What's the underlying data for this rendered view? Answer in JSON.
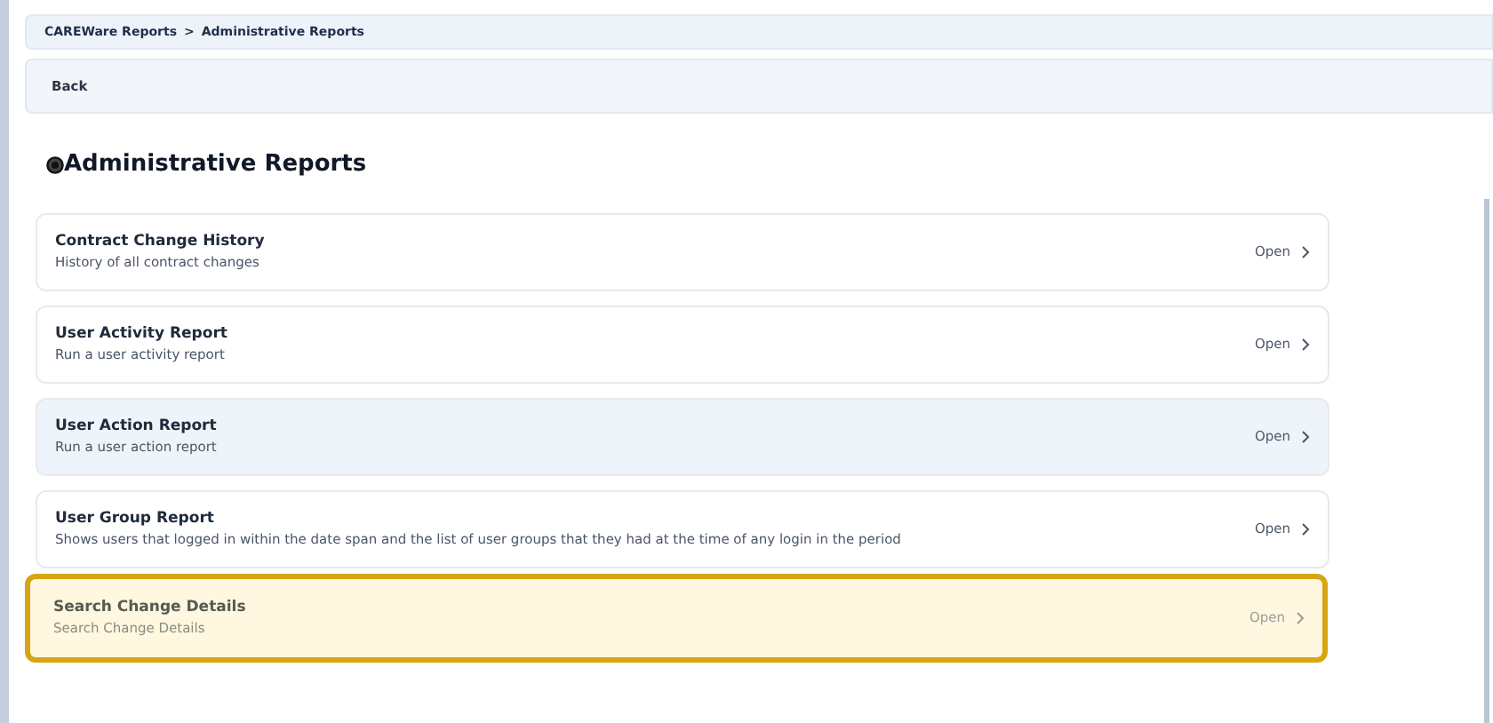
{
  "breadcrumb": [
    {
      "label": "CAREWare Reports"
    },
    {
      "label": "Administrative Reports"
    }
  ],
  "breadcrumb_separator": ">",
  "back_button": "Back",
  "heading": "Administrative Reports",
  "reports": [
    {
      "title": "Contract Change History",
      "description": "History of all contract changes",
      "action": "Open",
      "hovered": false,
      "highlighted": false
    },
    {
      "title": "User Activity Report",
      "description": "Run a user activity report",
      "action": "Open",
      "hovered": false,
      "highlighted": false
    },
    {
      "title": "User Action Report",
      "description": "Run a user action report",
      "action": "Open",
      "hovered": true,
      "highlighted": false
    },
    {
      "title": "User Group Report",
      "description": "Shows users that logged in within the date span and the list of user groups that they had at the time of any login in the period",
      "action": "Open",
      "hovered": false,
      "highlighted": false
    },
    {
      "title": "Search Change Details",
      "description": "Search Change Details",
      "action": "Open",
      "hovered": false,
      "highlighted": true
    }
  ]
}
